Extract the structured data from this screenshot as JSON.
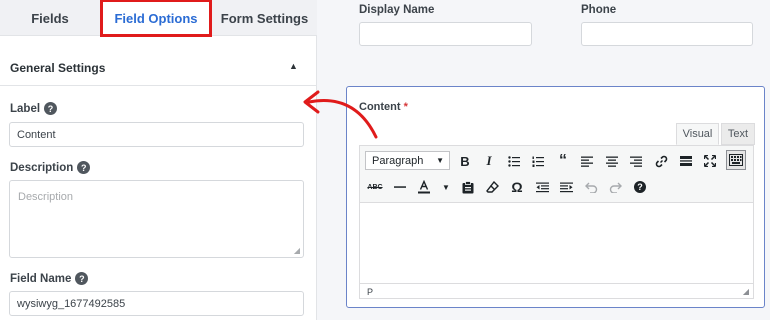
{
  "tabs": [
    {
      "label": "Fields"
    },
    {
      "label": "Field Options"
    },
    {
      "label": "Form Settings"
    }
  ],
  "general_settings": {
    "title": "General Settings"
  },
  "label_field": {
    "label": "Label",
    "value": "Content"
  },
  "description_field": {
    "label": "Description",
    "placeholder": "Description"
  },
  "field_name": {
    "label": "Field Name",
    "value": "wysiwyg_1677492585"
  },
  "form_preview": {
    "display_name_label": "Display Name",
    "phone_label": "Phone",
    "content_label": "Content",
    "required_mark": "*"
  },
  "editor": {
    "visual_tab": "Visual",
    "text_tab": "Text",
    "format_select": "Paragraph",
    "status_path": "P",
    "toolbar_row1": [
      "bold-icon",
      "italic-icon",
      "bullet-list-icon",
      "numbered-list-icon",
      "blockquote-icon",
      "align-left-icon",
      "align-center-icon",
      "align-right-icon",
      "link-icon",
      "read-more-icon",
      "fullscreen-icon",
      "toolbar-toggle-icon"
    ],
    "toolbar_row2": [
      "strikethrough-icon",
      "horizontal-line-icon",
      "text-color-icon",
      "paste-text-icon",
      "clear-formatting-icon",
      "special-character-icon",
      "outdent-icon",
      "indent-icon",
      "undo-icon",
      "redo-icon",
      "help-icon"
    ]
  },
  "colors": {
    "highlight_border": "#e01b1b",
    "active_tab_text": "#2b6cd4",
    "arrow": "#e01b1b",
    "content_box_border": "#6b84c9"
  }
}
